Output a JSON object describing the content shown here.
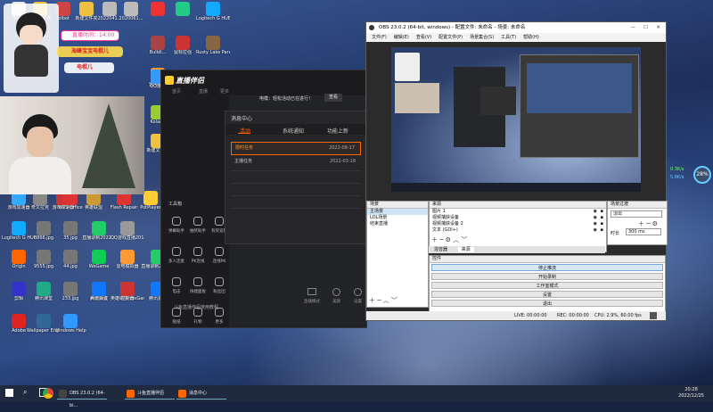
{
  "desktop_icons": [
    {
      "label": "Home",
      "color": "#e8e8e8"
    },
    {
      "label": "新建文件夹",
      "color": "#f0c040"
    },
    {
      "label": "lolbot",
      "color": "#c44"
    },
    {
      "label": "新建文件夹",
      "color": "#f0c040"
    },
    {
      "label": "2022041...",
      "color": "#bbb"
    },
    {
      "label": "2020061...",
      "color": "#bbb"
    },
    {
      "label": "",
      "color": "#e33"
    },
    {
      "label": "",
      "color": "#2c8"
    },
    {
      "label": "Logitech G HUB",
      "color": "#1af"
    },
    {
      "label": "鼠标拉强",
      "color": "#c33"
    },
    {
      "label": "Bulldi...",
      "color": "#a44"
    },
    {
      "label": "Rusty Lake Paradise",
      "color": "#864"
    },
    {
      "label": "雷电模拟",
      "color": "#f93"
    },
    {
      "label": "QQ游戏",
      "color": "#39f"
    },
    {
      "label": "Kolar...",
      "color": "#9c3"
    },
    {
      "label": "新建文件夹",
      "color": "#f0c040"
    },
    {
      "label": "游戏加速器",
      "color": "#3af"
    },
    {
      "label": "奇文拉克",
      "color": "#888"
    },
    {
      "label": "游戏加速器",
      "color": "#c33"
    },
    {
      "label": "英雄联盟",
      "color": "#c93"
    },
    {
      "label": "Flash Repair",
      "color": "#d33"
    },
    {
      "label": "PotPlayer",
      "color": "#fc3"
    },
    {
      "label": "WPS Office",
      "color": "#d33"
    },
    {
      "label": "Logitech G HUB",
      "color": "#1af"
    },
    {
      "label": "8866.jpg",
      "color": "#777"
    },
    {
      "label": "35.jpg",
      "color": "#777"
    },
    {
      "label": "直播录制2022...",
      "color": "#2c6"
    },
    {
      "label": "QQ游戏直播2018062...",
      "color": "#999"
    },
    {
      "label": "Origin",
      "color": "#f60"
    },
    {
      "label": "9555.jpg",
      "color": "#777"
    },
    {
      "label": "44.jpg",
      "color": "#777"
    },
    {
      "label": "WeGame",
      "color": "#1c5"
    },
    {
      "label": "雷电模拟器",
      "color": "#f93"
    },
    {
      "label": "直播录制2022...",
      "color": "#2c6"
    },
    {
      "label": "百度网盘",
      "color": "#39f"
    },
    {
      "label": "英雄联盟 WeGame版",
      "color": "#c93"
    },
    {
      "label": "腾讯会议",
      "color": "#17f"
    },
    {
      "label": "233.jpg",
      "color": "#777"
    },
    {
      "label": "腾讯会议",
      "color": "#17f"
    },
    {
      "label": "控制器",
      "color": "#c33"
    },
    {
      "label": "剪辑",
      "color": "#33c"
    },
    {
      "label": "腾讯课堂",
      "color": "#2a8"
    },
    {
      "label": "Adobe",
      "color": "#d22"
    },
    {
      "label": "Wallpaper Engine",
      "color": "#369"
    },
    {
      "label": "Windows Help",
      "color": "#39f"
    }
  ],
  "overlays": {
    "live_time": "直播时间：14:00",
    "fan_name": "海峰宝宝电棍儿",
    "nickname": "电棍儿"
  },
  "companion": {
    "logo": "直播伴侣",
    "nav": [
      "首页",
      "直播",
      "更多"
    ],
    "notice": "电模：轻松活动已在进行！",
    "notice_btn": "查看",
    "tool_title": "工具箱",
    "tools": [
      "弹幕助手",
      "抽奖助手",
      "有奖竞猜",
      "多人连麦",
      "PK连线",
      "连线PK",
      "电击",
      "快捷面板",
      "粉丝团",
      "贴纸",
      "礼物",
      "更多"
    ],
    "bottom_link": "斗鱼直播伴侣使用教程",
    "bottom_right": [
      "直播模式",
      "美颜",
      "设置"
    ]
  },
  "message_center": {
    "title": "消息中心",
    "tabs": [
      "活动",
      "系统通知",
      "功能上新"
    ],
    "rows": [
      {
        "title": "限时任务",
        "date": "2022-08-17",
        "highlight": true
      },
      {
        "title": "主播任务",
        "date": "2022-03-18",
        "highlight": false
      }
    ]
  },
  "obs": {
    "title": "OBS 23.0.2 (64-bit, windows) - 配置文件: 未命名 - 场景: 未命名",
    "menu": [
      "文件(F)",
      "编辑(E)",
      "查看(V)",
      "配置文件(P)",
      "场景集合(S)",
      "工具(T)",
      "帮助(H)"
    ],
    "panels": {
      "scenes": {
        "title": "场景",
        "items": [
          "主场景",
          "LOL场景",
          "结束直播"
        ]
      },
      "sources": {
        "title": "来源",
        "items": [
          "图片 1",
          "视频捕获设备",
          "视频捕获设备 2",
          "文本 (GDI+)"
        ],
        "tabs": [
          "混音器",
          "来源"
        ]
      },
      "transitions": {
        "title": "场景过渡",
        "value": "淡出",
        "duration_label": "时长",
        "duration": "300 ms"
      },
      "controls": {
        "title": "控件",
        "buttons": [
          "停止推流",
          "开始录制",
          "工作室模式",
          "设置",
          "退出"
        ]
      }
    },
    "status": {
      "live": "LIVE: 00:00:00",
      "rec": "REC: 00:00:00",
      "cpu": "CPU: 2.9%, 60.00 fps"
    }
  },
  "net_widget": {
    "percent": "28%",
    "up": "0.3K/s",
    "down": "5.8K/s"
  },
  "taskbar": {
    "apps": [
      {
        "label": "OBS 23.0.2 (64-bi...",
        "color": "#444"
      },
      {
        "label": "斗鱼直播伴侣",
        "color": "#f60"
      },
      {
        "label": "消息中心",
        "color": "#f60"
      }
    ],
    "time": "20:28",
    "date": "2022/12/25"
  }
}
